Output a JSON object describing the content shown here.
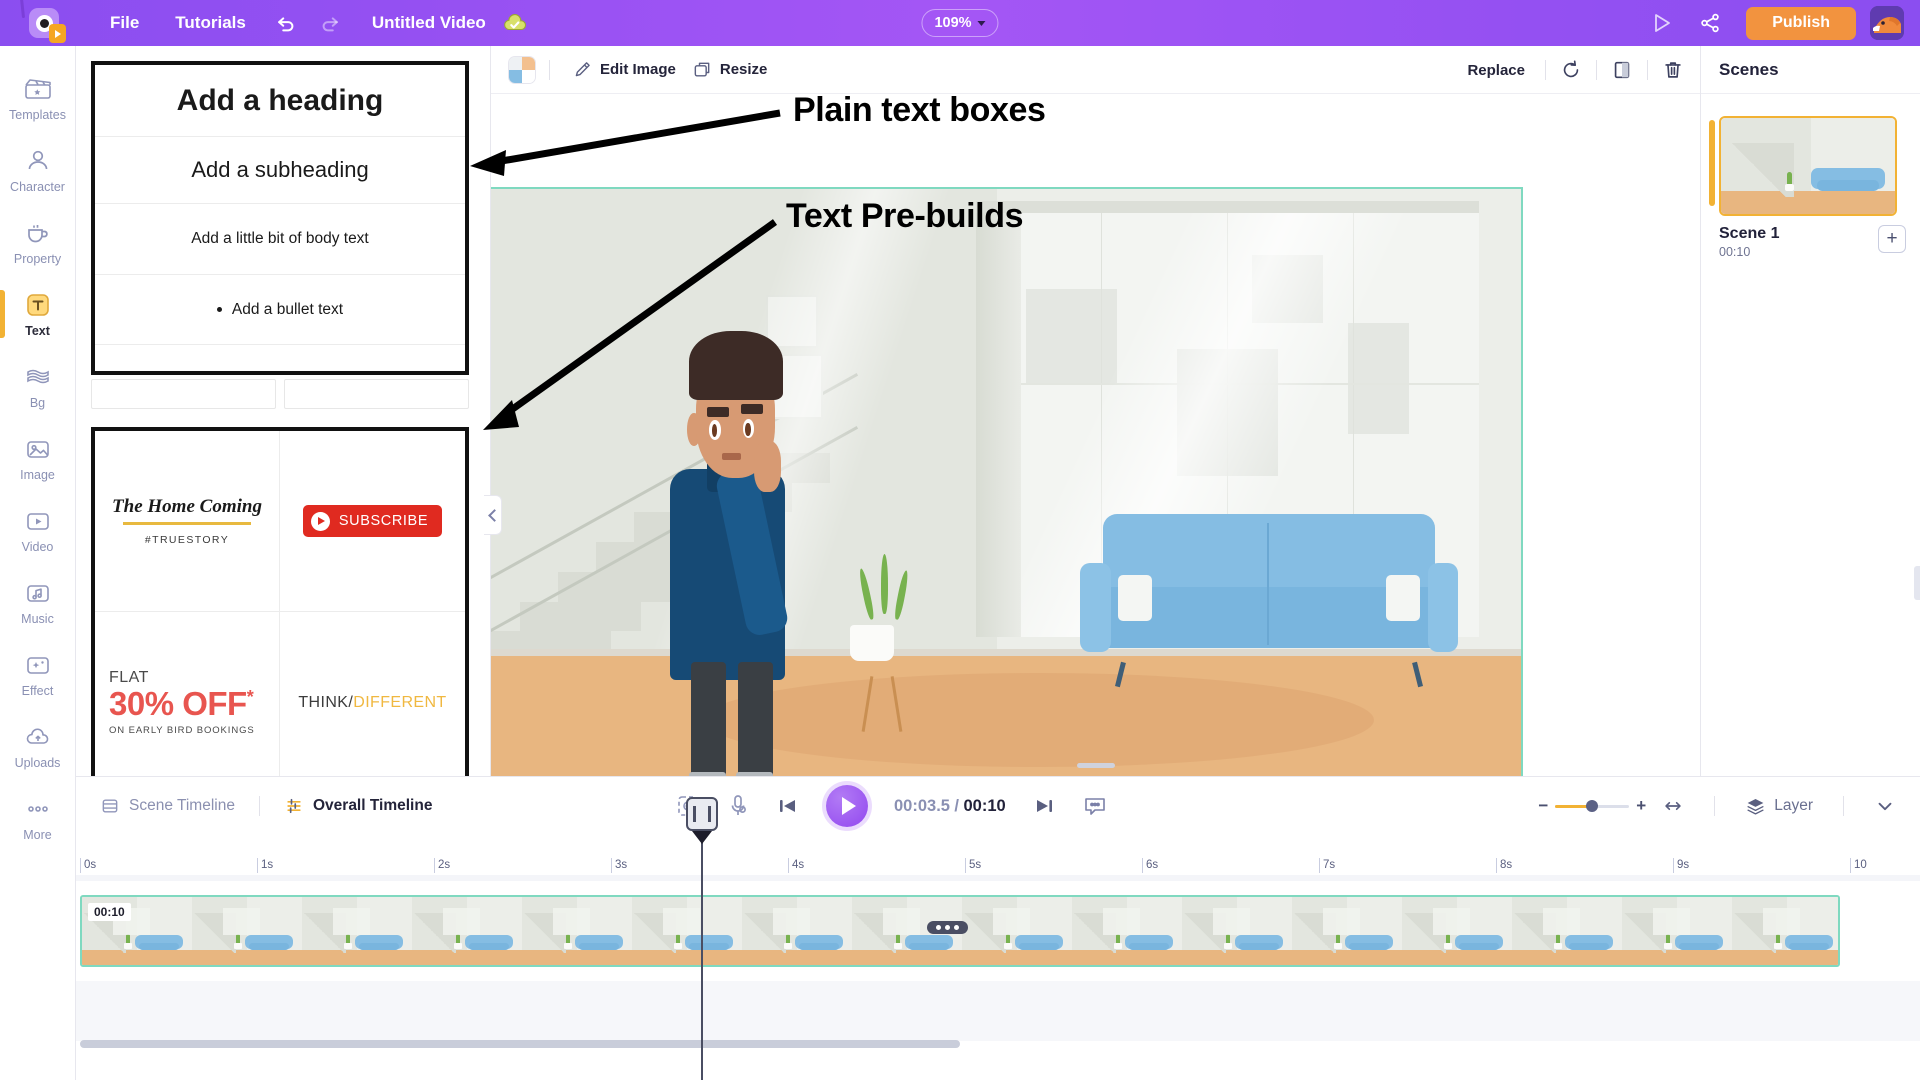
{
  "topbar": {
    "logo_name": "animaker-logo",
    "menu": [
      {
        "label": "File",
        "name": "menu-file"
      },
      {
        "label": "Tutorials",
        "name": "menu-tutorials"
      }
    ],
    "undo_icon": "undo-icon",
    "redo_icon": "redo-icon",
    "doc_title": "Untitled Video",
    "cloud_saved_icon": "cloud-check-icon",
    "zoom": {
      "value": "109%",
      "caret_icon": "chevron-down-icon"
    },
    "preview_icon": "play-preview-icon",
    "share_icon": "share-icon",
    "publish_label": "Publish",
    "avatar_name": "user-avatar"
  },
  "rail": {
    "items": [
      {
        "label": "Templates",
        "icon": "templates-icon",
        "active": false
      },
      {
        "label": "Character",
        "icon": "character-icon",
        "active": false
      },
      {
        "label": "Property",
        "icon": "property-icon",
        "active": false
      },
      {
        "label": "Text",
        "icon": "text-icon",
        "active": true
      },
      {
        "label": "Bg",
        "icon": "background-icon",
        "active": false
      },
      {
        "label": "Image",
        "icon": "image-icon",
        "active": false
      },
      {
        "label": "Video",
        "icon": "video-icon",
        "active": false
      },
      {
        "label": "Music",
        "icon": "music-icon",
        "active": false
      },
      {
        "label": "Effect",
        "icon": "effect-icon",
        "active": false
      },
      {
        "label": "Uploads",
        "icon": "uploads-icon",
        "active": false
      },
      {
        "label": "More",
        "icon": "more-icon",
        "active": false
      }
    ]
  },
  "text_panel": {
    "plain_text_boxes": [
      {
        "label": "Add a heading"
      },
      {
        "label": "Add a subheading"
      },
      {
        "label": "Add a little bit of body text"
      },
      {
        "label": "Add a bullet text"
      }
    ],
    "prebuilds": [
      {
        "name": "the-home-coming",
        "title": "The Home Coming",
        "tag": "#TRUESTORY"
      },
      {
        "name": "subscribe-button",
        "label": "SUBSCRIBE"
      },
      {
        "name": "flat-discount",
        "line1": "FLAT",
        "line2": "30% OFF",
        "sup": "*",
        "line3": "ON EARLY BIRD BOOKINGS"
      },
      {
        "name": "think-different",
        "part1": "THINK/",
        "part2": "DIFFERENT"
      }
    ]
  },
  "canvas_toolbar": {
    "swatch_icon": "color-swatch-icon",
    "edit_image_label": "Edit Image",
    "edit_image_icon": "brush-icon",
    "resize_label": "Resize",
    "resize_icon": "resize-icon",
    "replace_label": "Replace",
    "rotate_icon": "rotate-icon",
    "flip_icon": "flip-icon",
    "delete_icon": "trash-icon"
  },
  "annotations": [
    {
      "name": "annotation-plain-text-boxes",
      "label": "Plain text boxes"
    },
    {
      "name": "annotation-text-prebuilds",
      "label": "Text Pre-builds"
    }
  ],
  "scenes": {
    "header": "Scenes",
    "items": [
      {
        "name": "Scene 1",
        "duration": "00:10",
        "selected": true
      }
    ],
    "add_label": "+"
  },
  "timeline": {
    "tabs": [
      {
        "label": "Scene Timeline",
        "icon": "scene-timeline-icon",
        "active": false
      },
      {
        "label": "Overall Timeline",
        "icon": "overall-timeline-icon",
        "active": true
      }
    ],
    "fit_icon": "fit-to-screen-icon",
    "mic_icon": "record-voice-icon",
    "prev_icon": "skip-previous-icon",
    "play_icon": "play-icon",
    "next_icon": "skip-next-icon",
    "subtitle_icon": "subtitle-icon",
    "current_time": "00:03.5",
    "separator": "/",
    "total_time": "00:10",
    "zoom_minus": "−",
    "zoom_plus": "+",
    "fit_width_icon": "fit-width-icon",
    "layer_label": "Layer",
    "layer_icon": "layers-icon",
    "collapse_icon": "chevron-down-icon",
    "ruler_ticks": [
      "0s",
      "1s",
      "2s",
      "3s",
      "4s",
      "5s",
      "6s",
      "7s",
      "8s",
      "9s",
      "10"
    ],
    "clip": {
      "duration_badge": "00:10",
      "options_icon": "more-options-icon"
    }
  },
  "colors": {
    "brand_purple": "#9450f2",
    "publish_orange": "#f2933f",
    "accent_yellow": "#f2b234",
    "clip_border_green": "#7fd9c0",
    "panel_border_black": "#111111",
    "subscribe_red": "#e02a20",
    "discount_red": "#e8554f",
    "think_yellow": "#f0b840"
  }
}
